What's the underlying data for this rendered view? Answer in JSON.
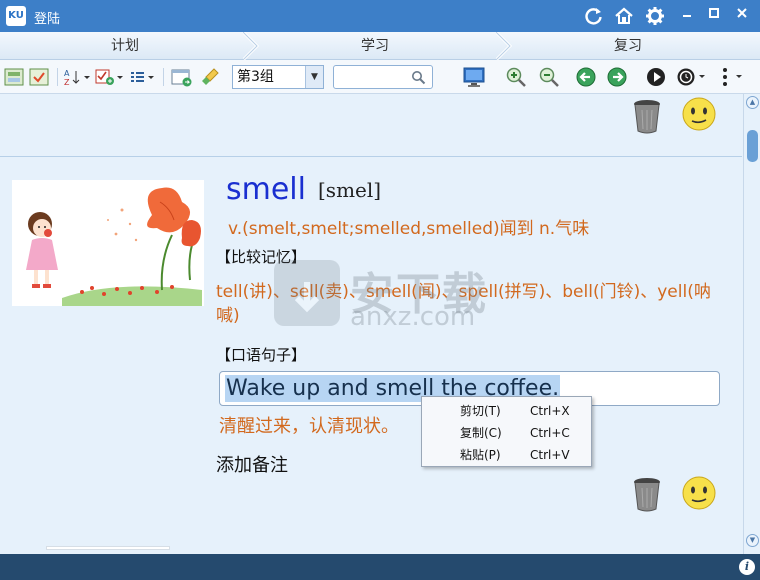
{
  "window": {
    "app_logo": "KU",
    "title": "登陆"
  },
  "steps": [
    "计划",
    "学习",
    "复习"
  ],
  "toolbar": {
    "group_value": "第3组",
    "search_placeholder": ""
  },
  "card": {
    "word": "smell",
    "phonetic": "[smel]",
    "definition": "v.(smelt,smelt;smelled,smelled)闻到 n.气味",
    "compare_heading": "【比较记忆】",
    "compare_text": "tell(讲)、sell(卖)、smell(闻)、spell(拼写)、bell(门铃)、yell(呐喊)",
    "spoken_heading": "【口语句子】",
    "sentence": "Wake up and smell the coffee.",
    "translation": "清醒过来，认清现状。",
    "add_note": "添加备注"
  },
  "context_menu": [
    {
      "label": "剪切(T)",
      "shortcut": "Ctrl+X"
    },
    {
      "label": "复制(C)",
      "shortcut": "Ctrl+C"
    },
    {
      "label": "粘贴(P)",
      "shortcut": "Ctrl+V"
    }
  ],
  "watermark": {
    "text": "安下载",
    "url": "anxz.com"
  },
  "colors": {
    "titlebar": "#3d7fc8",
    "word": "#1a2fd0",
    "accent_text": "#d2691e",
    "bottom_bar": "#254a6e"
  }
}
